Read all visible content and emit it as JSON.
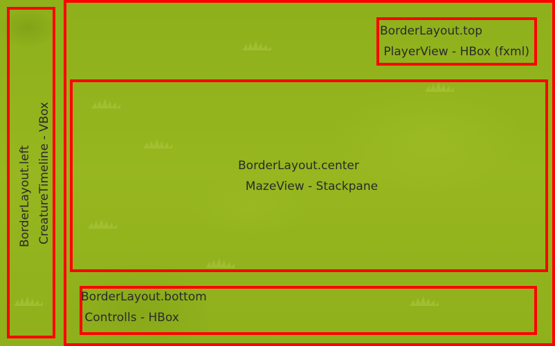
{
  "left": {
    "title": "BorderLayout.left",
    "component": "CreatureTimeline - VBox"
  },
  "top": {
    "title": "BorderLayout.top",
    "component": " PlayerView - HBox (fxml)"
  },
  "center": {
    "title": "BorderLayout.center",
    "component": "  MazeView - Stackpane"
  },
  "bottom": {
    "title": "BorderLayout.bottom",
    "component": " Controlls - HBox"
  },
  "colors": {
    "border": "#ff0000",
    "background": "#8fb01c"
  },
  "icons": [
    "grass-tuft-icon"
  ]
}
